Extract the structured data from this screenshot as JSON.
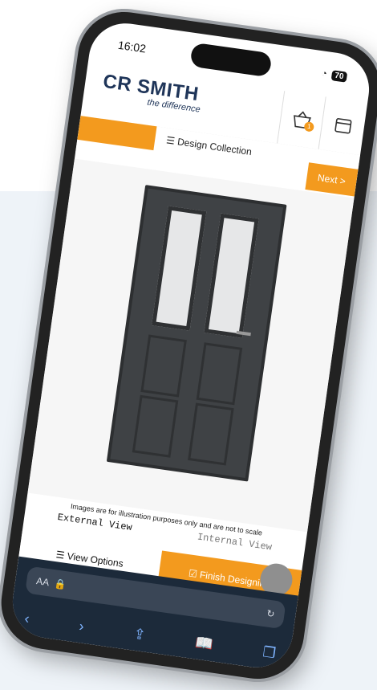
{
  "status": {
    "time": "16:02",
    "battery": "70"
  },
  "brand": {
    "name": "CR SMITH",
    "tagline": "the difference"
  },
  "header": {
    "basket_count": "1"
  },
  "subbar": {
    "design_collection": "Design Collection",
    "next": "Next >"
  },
  "preview": {
    "disclaimer": "Images are for illustration purposes only and are not to scale"
  },
  "views": {
    "external": "External View",
    "internal": "Internal View"
  },
  "actions": {
    "view_options": "View Options",
    "finish_designing": "Finish Designing"
  },
  "safari": {
    "aa": "AA"
  },
  "colors": {
    "accent": "#f39a1e",
    "brand": "#1f3559"
  }
}
